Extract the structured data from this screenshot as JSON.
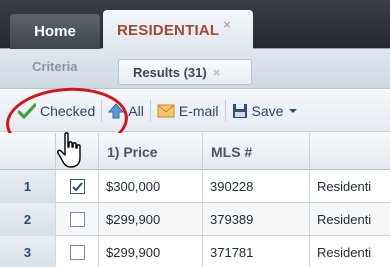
{
  "tabs": {
    "home_label": "Home",
    "active_label": "RESIDENTIAL",
    "active_close": "×"
  },
  "subtabs": {
    "criteria_label": "Criteria",
    "results_label": "Results (31)",
    "results_close": "×"
  },
  "toolbar": {
    "checked_label": "Checked",
    "checked_icon": "checkmark-icon",
    "all_label": "All",
    "all_icon": "arrow-up-icon",
    "email_label": "E-mail",
    "email_icon": "envelope-icon",
    "save_label": "Save",
    "save_icon": "floppy-disk-icon"
  },
  "grid": {
    "columns": [
      "",
      "",
      "1) Price",
      "MLS #",
      ""
    ],
    "rows": [
      {
        "num": "1",
        "checked": true,
        "price": "$300,000",
        "mls": "390228",
        "type": "Residenti"
      },
      {
        "num": "2",
        "checked": false,
        "price": "$299,900",
        "mls": "379389",
        "type": "Residenti"
      },
      {
        "num": "3",
        "checked": false,
        "price": "$299,900",
        "mls": "371781",
        "type": "Residenti"
      }
    ]
  },
  "colors": {
    "tab_active_text": "#a14a2e",
    "highlight_ring": "#d4121a",
    "check_green": "#3fa23a"
  }
}
